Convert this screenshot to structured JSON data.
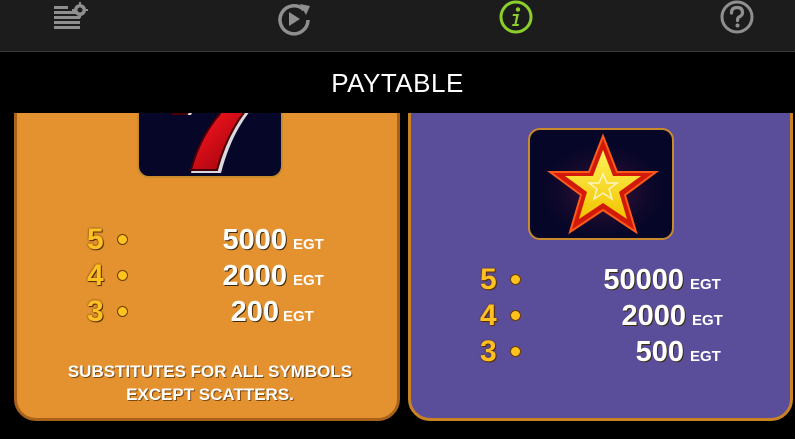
{
  "toolbar": {
    "icons": [
      {
        "name": "settings-lines-icon"
      },
      {
        "name": "replay-icon"
      },
      {
        "name": "info-icon",
        "color": "#8bd02a"
      },
      {
        "name": "help-icon"
      }
    ]
  },
  "title": "PAYTABLE",
  "colors": {
    "wild_panel": "#e3922f",
    "scatter_panel": "#5a4e9a",
    "count_gold": "#ffc021"
  },
  "wild_panel": {
    "symbol": "red-seven",
    "pays": [
      {
        "count": "5",
        "amount": "5000",
        "currency": "EGT"
      },
      {
        "count": "4",
        "amount": "2000",
        "currency": "EGT"
      },
      {
        "count": "3",
        "amount": "200",
        "currency": "EGT"
      }
    ],
    "note_line1": "SUBSTITUTES FOR ALL SYMBOLS",
    "note_line2": "EXCEPT SCATTERS."
  },
  "scatter_panel": {
    "symbol": "gold-star",
    "pays": [
      {
        "count": "5",
        "amount": "50000",
        "currency": "EGT"
      },
      {
        "count": "4",
        "amount": "2000",
        "currency": "EGT"
      },
      {
        "count": "3",
        "amount": "500",
        "currency": "EGT"
      }
    ]
  }
}
